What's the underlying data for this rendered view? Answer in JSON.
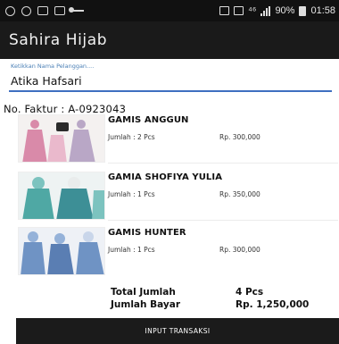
{
  "status_bar": {
    "indicators": "⁴⁶",
    "battery": "90%",
    "time": "01:58"
  },
  "app": {
    "title": "Sahira Hijab"
  },
  "customer": {
    "hint": "Ketikkan Nama Pelanggan....",
    "value": "Atika Hafsari"
  },
  "invoice": {
    "text": "No. Faktur : A-0923043"
  },
  "items": [
    {
      "name": "GAMIS ANGGUN",
      "qty": "Jumlah : 2 Pcs",
      "price": "Rp. 300,000",
      "colors": [
        "#d98aa9",
        "#b9a7c6",
        "#eab9cc"
      ]
    },
    {
      "name": "GAMIA SHOFIYA YULIA",
      "qty": "Jumlah : 1 Pcs",
      "price": "Rp. 350,000",
      "colors": [
        "#4fa8a4",
        "#7cc3bf",
        "#3d8f96"
      ]
    },
    {
      "name": "GAMIS HUNTER",
      "qty": "Jumlah : 1 Pcs",
      "price": "Rp. 300,000",
      "colors": [
        "#6f93c4",
        "#95b2d9",
        "#5a7eb3"
      ]
    }
  ],
  "totals": {
    "total_label": "Total Jumlah",
    "total_value": "4 Pcs",
    "pay_label": "Jumlah Bayar",
    "pay_value": "Rp. 1,250,000"
  },
  "action": {
    "label": "INPUT TRANSAKSI"
  }
}
